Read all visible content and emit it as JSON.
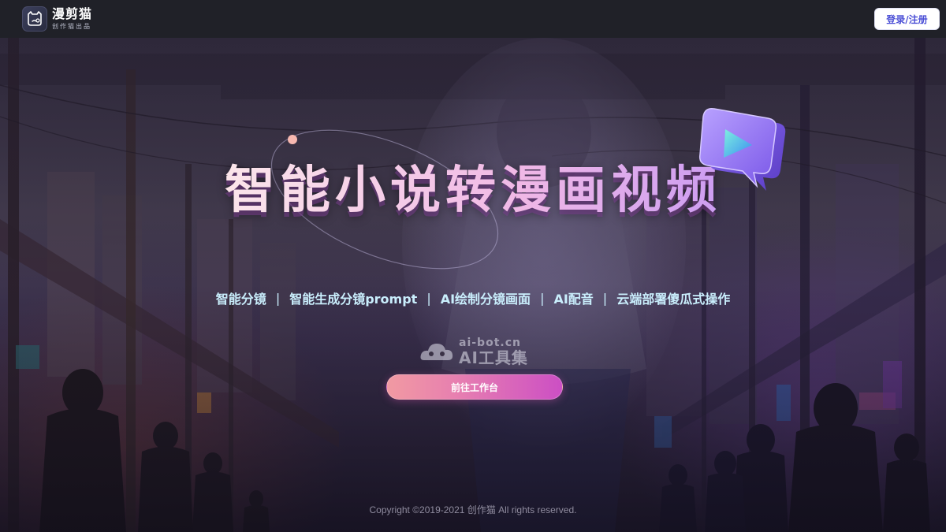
{
  "header": {
    "brand_name": "漫剪猫",
    "brand_sub": "创作猫出品",
    "login_label": "登录/注册"
  },
  "hero": {
    "headline": "智能小说转漫画视频",
    "features": [
      "智能分镜",
      "智能生成分镜prompt",
      "AI绘制分镜画面",
      "AI配音",
      "云端部署傻瓜式操作"
    ],
    "separator": "|",
    "cta_label": "前往工作台"
  },
  "watermark": {
    "url": "ai-bot.cn",
    "name": "AI工具集"
  },
  "footer": {
    "copyright": "Copyright ©2019-2021 创作猫 All rights reserved."
  },
  "colors": {
    "topbar": "#202128",
    "login_text": "#4b4fd6",
    "feature_text": "#c9eefc",
    "cta_start": "#f19aa2",
    "cta_end": "#cc4fc4"
  },
  "icons": [
    "cat-logo-icon",
    "play-icon",
    "cloud-logo-icon"
  ]
}
